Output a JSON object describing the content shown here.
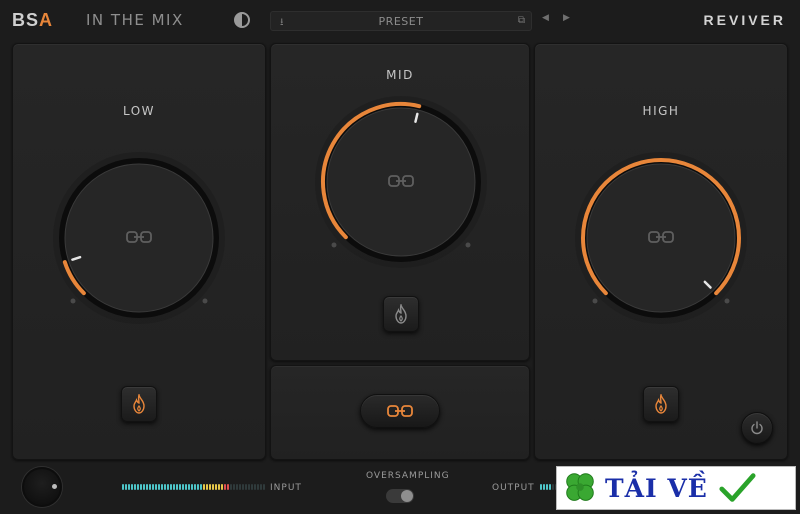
{
  "header": {
    "logo_prefix": "BS",
    "logo_accent": "A",
    "product_name": "IN THE MIX",
    "preset_label": "PRESET",
    "brand": "REVIVER",
    "icons": {
      "theme": "contrast-icon",
      "save": "download-icon",
      "export": "export-icon",
      "prev": "chevron-left-icon",
      "next": "chevron-right-icon"
    }
  },
  "bands": {
    "low": {
      "label": "LOW",
      "value": 0.1
    },
    "mid": {
      "label": "MID",
      "value": 0.55
    },
    "high": {
      "label": "HIGH",
      "value": 1.0
    }
  },
  "footer": {
    "input_label": "INPUT",
    "output_label": "OUTPUT",
    "oversampling_label": "OVERSAMPLING",
    "oversampling_on": true
  },
  "watermark": {
    "text": "TẢI VỀ"
  },
  "colors": {
    "accent": "#e8863a",
    "background": "#1c1c1c",
    "panel": "#252525",
    "meter_cyan": "#4ec6c9",
    "meter_yellow": "#e7c84a",
    "meter_red": "#e05050"
  }
}
